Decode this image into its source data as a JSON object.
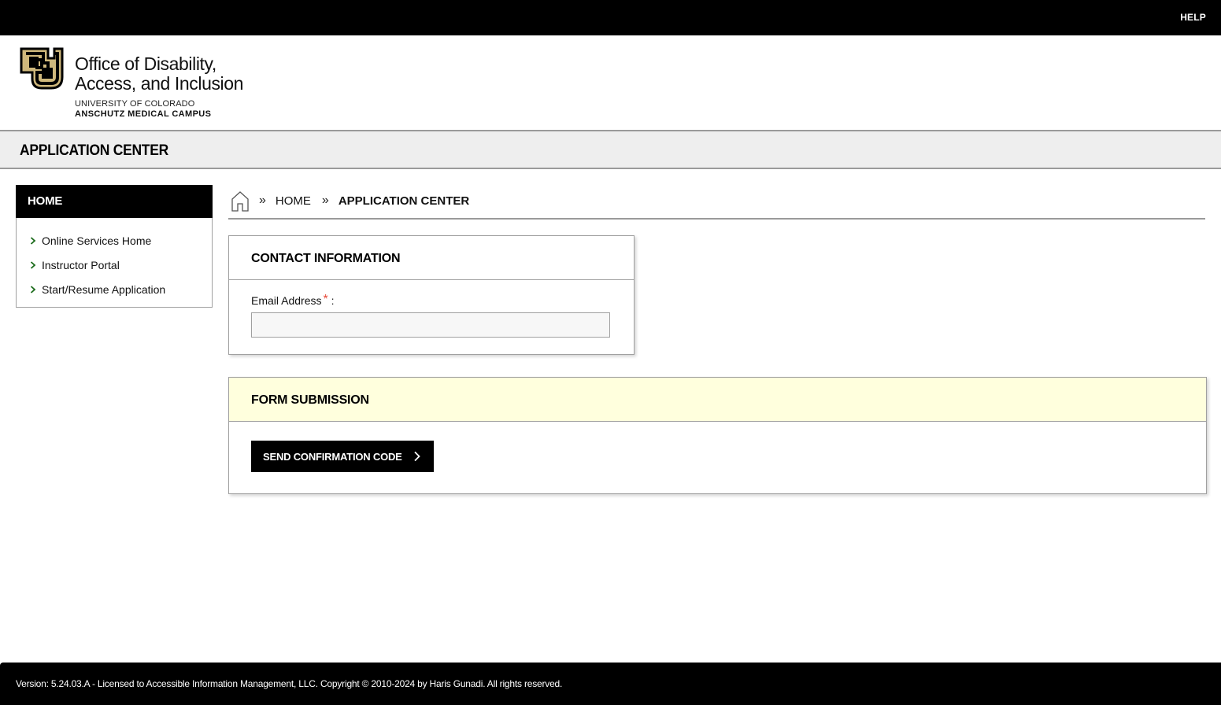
{
  "topbar": {
    "help_label": "HELP"
  },
  "logo": {
    "line1": "Office of Disability,",
    "line2": "Access, and Inclusion",
    "university": "UNIVERSITY OF COLORADO",
    "campus": "ANSCHUTZ MEDICAL CAMPUS",
    "icon": "cu-logo-icon",
    "colors": {
      "gold": "#cfb87c",
      "black": "#000000"
    }
  },
  "page": {
    "title": "APPLICATION CENTER"
  },
  "sidebar": {
    "heading": "HOME",
    "items": [
      {
        "label": "Online Services Home",
        "icon": "chevron-right-icon"
      },
      {
        "label": "Instructor Portal",
        "icon": "chevron-right-icon"
      },
      {
        "label": "Start/Resume Application",
        "icon": "chevron-right-icon"
      }
    ],
    "chevron_color": "#1a6b1a"
  },
  "breadcrumb": {
    "home_icon": "home-icon",
    "separator": "»",
    "items": [
      {
        "label": "HOME"
      }
    ],
    "current": "APPLICATION CENTER"
  },
  "contact": {
    "heading": "CONTACT INFORMATION",
    "email_label": "Email Address",
    "required_marker": "*",
    "label_suffix": ":",
    "email_value": "",
    "required_color": "#e74c3c"
  },
  "submission": {
    "heading": "FORM SUBMISSION",
    "button_label": "SEND CONFIRMATION CODE",
    "button_icon": "chevron-right-icon",
    "header_bg": "#ffffdd"
  },
  "footer": {
    "text": "Version: 5.24.03.A - Licensed to Accessible Information Management, LLC. Copyright © 2010-2024 by Haris Gunadi. All rights reserved."
  }
}
